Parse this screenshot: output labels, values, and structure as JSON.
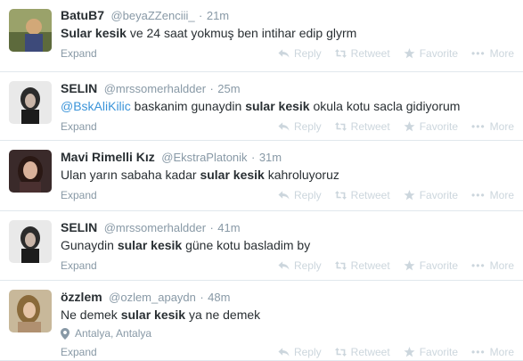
{
  "actions": {
    "expand": "Expand",
    "reply": "Reply",
    "retweet": "Retweet",
    "favorite": "Favorite",
    "more": "More"
  },
  "separator": "·",
  "tweets": [
    {
      "fullname": "BatuB7",
      "username": "@beyaZZenciii_",
      "time": "21m",
      "before": "",
      "mention": "",
      "pre": "",
      "bold": "sular kesik",
      "post": " ve 24 saat yokmuş ben intihar edip glyrm",
      "capitalized_bold": "Sular kesik"
    },
    {
      "fullname": "SELIN",
      "username": "@mrssomerhaldder",
      "time": "25m",
      "mention": "@BskAliKilic",
      "pre": " baskanim gunaydin ",
      "bold": "sular kesik",
      "post": " okula kotu sacla gidiyorum"
    },
    {
      "fullname": "Mavi Rimelli Kız",
      "username": "@EkstraPlatonik",
      "time": "31m",
      "pre": "Ulan yarın sabaha kadar ",
      "bold": "sular kesik",
      "post": " kahroluyoruz"
    },
    {
      "fullname": "SELIN",
      "username": "@mrssomerhaldder",
      "time": "41m",
      "pre": "Gunaydin ",
      "bold": "sular kesik",
      "post": " güne kotu basladim by"
    },
    {
      "fullname": "özzlem",
      "username": "@ozlem_apaydn",
      "time": "48m",
      "pre": "Ne demek ",
      "bold": "sular kesik",
      "post": " ya ne demek",
      "location": "Antalya, Antalya"
    }
  ],
  "colors": {
    "text": "#292f33",
    "muted": "#8899a6",
    "action_icons": "#ccd6dd",
    "link": "#3b94d9",
    "divider": "#e1e8ed"
  },
  "icons": [
    "reply-icon",
    "retweet-icon",
    "favorite-star-icon",
    "more-dots-icon",
    "location-pin-icon"
  ]
}
